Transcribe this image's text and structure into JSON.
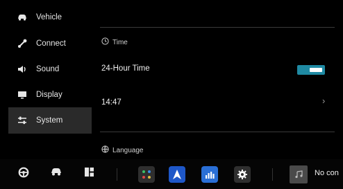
{
  "sidebar": {
    "items": [
      {
        "label": "Vehicle",
        "icon": "car-icon"
      },
      {
        "label": "Connect",
        "icon": "link-icon"
      },
      {
        "label": "Sound",
        "icon": "speaker-icon"
      },
      {
        "label": "Display",
        "icon": "monitor-icon"
      },
      {
        "label": "System",
        "icon": "sliders-icon",
        "active": true
      }
    ]
  },
  "main": {
    "time_section": {
      "title": "Time",
      "icon": "clock-icon"
    },
    "hour24": {
      "label": "24-Hour Time",
      "enabled": true
    },
    "clock": {
      "value": "14:47"
    },
    "language_section": {
      "title": "Language",
      "icon": "globe-icon"
    }
  },
  "dock": {
    "icons": [
      "steering-wheel-icon",
      "car-icon",
      "grid-layout-icon",
      "phone-app-icon",
      "navigation-icon",
      "equalizer-icon",
      "settings-icon"
    ]
  },
  "media": {
    "title": "No con",
    "icon": "music-note-icon"
  },
  "colors": {
    "accent": "#1f8aa3",
    "active_bg": "#2a2a2a",
    "background": "#000000"
  }
}
